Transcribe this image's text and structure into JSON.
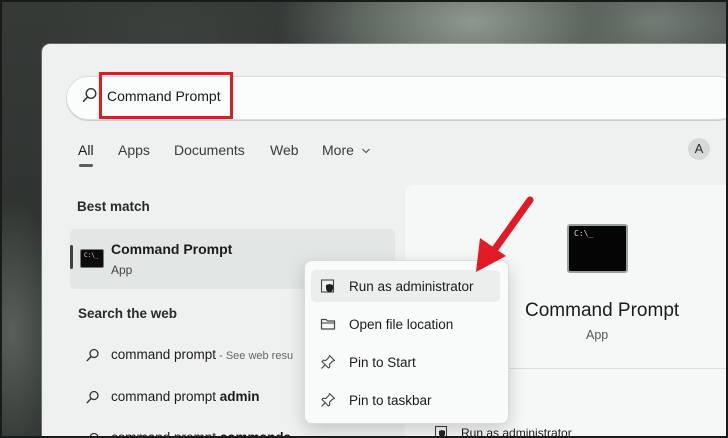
{
  "search": {
    "value": "Command Prompt"
  },
  "tabs": [
    {
      "label": "All"
    },
    {
      "label": "Apps"
    },
    {
      "label": "Documents"
    },
    {
      "label": "Web"
    },
    {
      "label": "More"
    }
  ],
  "avatar": {
    "initial": "A"
  },
  "best_match": {
    "heading": "Best match",
    "title": "Command Prompt",
    "subtitle": "App"
  },
  "web": {
    "heading": "Search the web",
    "items": [
      {
        "text": "command prompt",
        "hint": " - See web resu"
      },
      {
        "text": "command prompt ",
        "bold": "admin"
      },
      {
        "text": "command prompt ",
        "bold": "commands"
      }
    ]
  },
  "detail": {
    "title": "Command Prompt",
    "subtitle": "App",
    "action": "Run as administrator"
  },
  "context_menu": {
    "items": [
      {
        "label": "Run as administrator",
        "icon": "shield-icon"
      },
      {
        "label": "Open file location",
        "icon": "folder-icon"
      },
      {
        "label": "Pin to Start",
        "icon": "pin-icon"
      },
      {
        "label": "Pin to taskbar",
        "icon": "pin-icon"
      }
    ]
  },
  "colors": {
    "highlight": "#e01b24",
    "arrow": "#e01b24"
  }
}
